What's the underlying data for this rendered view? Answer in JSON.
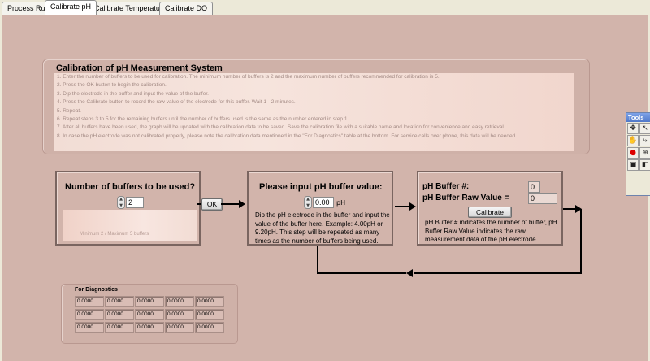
{
  "tabs": [
    "Process Run",
    "Calibrate pH",
    "Calibrate Temperature",
    "Calibrate DO"
  ],
  "intro": {
    "title": "Calibration of pH Measurement System",
    "lines": [
      "1. Enter the number of buffers to be used for calibration. The minimum number of buffers is 2 and the maximum number of buffers recommended for calibration is 5.",
      "2. Press the OK button to begin the calibration.",
      "3. Dip the electrode in the buffer and input the value of the buffer.",
      "4. Press the Calibrate button to record the raw value of the electrode for this buffer. Wait 1 - 2 minutes.",
      "5. Repeat.",
      "6. Repeat steps 3 to 5 for the remaining buffers until the number of buffers used is the same as the number entered in step 1.",
      "7. After all buffers have been used, the graph will be updated with the calibration data to be saved. Save the calibration file with a suitable name and location for convenience and easy retrieval.",
      "8. In case the pH electrode was not calibrated properly, please note the calibration data mentioned in the \"For Diagnostics\" table at the bottom. For service calls over phone, this data will be needed."
    ]
  },
  "buffers_box": {
    "title": "Number of buffers to be used?",
    "value": "2",
    "faint_caption": "Minimum 2 / Maximum 5 buffers"
  },
  "ok_button": "OK",
  "input_box": {
    "title": "Please input pH buffer value:",
    "value": "0.00",
    "unit": "pH",
    "description": "Dip the pH electrode in the buffer and input the value of the buffer here. Example: 4.00pH or 9.20pH. This step will be repeated as many times as the number of buffers being used."
  },
  "raw_box": {
    "buffer_num_label": "pH Buffer #:",
    "buffer_num_value": "0",
    "raw_value_label": "pH Buffer Raw Value =",
    "raw_value": "0",
    "calibrate_button": "Calibrate",
    "description": "pH Buffer # indicates the number of buffer, pH Buffer Raw Value indicates the raw measurement data of the pH electrode."
  },
  "diagnostics": {
    "label": "For Diagnostics",
    "rows": [
      [
        "0.0000",
        "0.0000",
        "0.0000",
        "0.0000",
        "0.0000"
      ],
      [
        "0.0000",
        "0.0000",
        "0.0000",
        "0.0000",
        "0.0000"
      ],
      [
        "0.0000",
        "0.0000",
        "0.0000",
        "0.0000",
        "0.0000"
      ]
    ]
  },
  "tools_palette": {
    "title": "Tools",
    "icons": [
      "operate-icon",
      "position-icon",
      "hand-icon",
      "wiring-icon",
      "breakpoint-icon",
      "probe-icon",
      "color-copy-icon",
      "color-icon"
    ]
  }
}
